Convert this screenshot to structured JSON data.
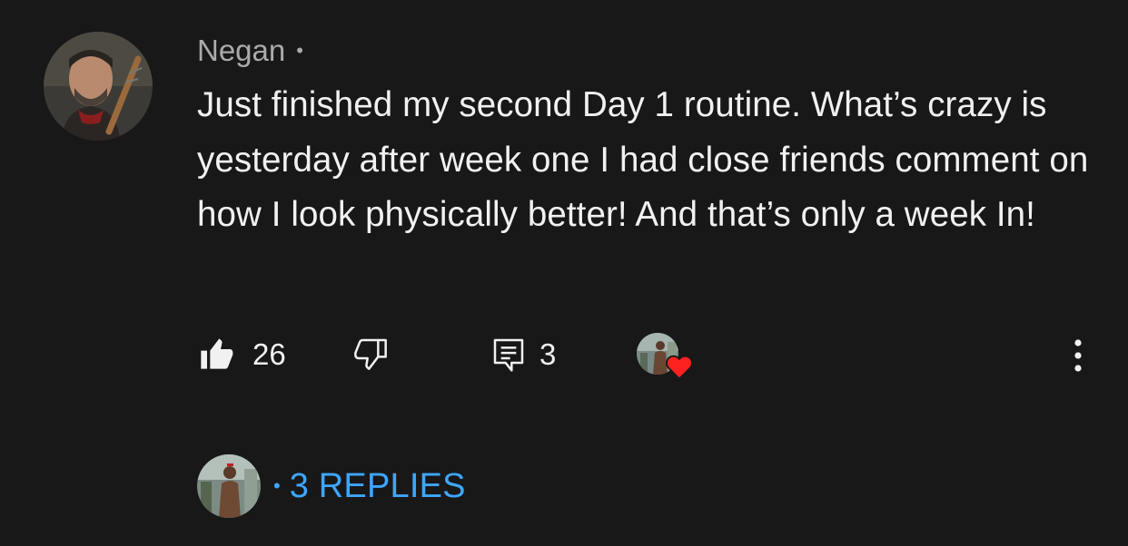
{
  "comment": {
    "author": "Negan",
    "author_separator": "•",
    "text": "Just finished my second Day 1 routine. What’s crazy is yesterday after week one I had close friends comment on how I look physically better! And that’s only a week In!",
    "like_count": "26",
    "reply_count": "3",
    "creator_heart": true
  },
  "replies": {
    "separator": "•",
    "label": "3 REPLIES"
  },
  "colors": {
    "background": "#181818",
    "text": "#f1f1f1",
    "muted": "#aaaaaa",
    "link": "#3ea6ff",
    "heart": "#ff2020"
  },
  "icons": {
    "like": "thumb-up-icon",
    "dislike": "thumb-down-icon",
    "reply": "comment-icon",
    "heart": "heart-icon",
    "more": "more-vert-icon"
  }
}
